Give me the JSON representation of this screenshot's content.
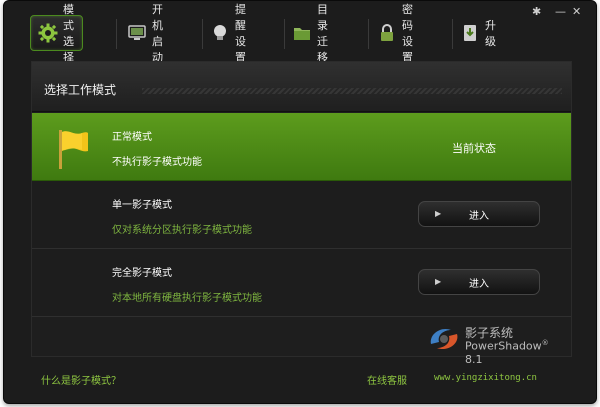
{
  "window": {
    "controls": {
      "settings": "✱",
      "minimize": "—",
      "close": "✕"
    }
  },
  "tabs": [
    {
      "label": "模式选择",
      "icon": "gear-icon",
      "active": true
    },
    {
      "label": "开机启动",
      "icon": "computer-icon",
      "active": false
    },
    {
      "label": "提醒设置",
      "icon": "lightbulb-icon",
      "active": false
    },
    {
      "label": "目录迁移",
      "icon": "folder-icon",
      "active": false
    },
    {
      "label": "密码设置",
      "icon": "lock-icon",
      "active": false
    },
    {
      "label": "升级",
      "icon": "download-icon",
      "active": false
    }
  ],
  "panel": {
    "title": "选择工作模式",
    "modes": [
      {
        "title": "正常模式",
        "desc": "不执行影子模式功能",
        "status": "当前状态",
        "icon": "flag-icon"
      },
      {
        "title": "单一影子模式",
        "desc": "仅对系统分区执行影子模式功能",
        "button": "进入"
      },
      {
        "title": "完全影子模式",
        "desc": "对本地所有硬盘执行影子模式功能",
        "button": "进入"
      }
    ]
  },
  "logo": {
    "name": "影子系统",
    "version_text": "PowerShadow",
    "version_mark": "®",
    "version_num": "8.1"
  },
  "footer": {
    "what_link": "什么是影子模式？",
    "service_link": "在线客服",
    "site_link": "www.yingzixitong.cn"
  },
  "colors": {
    "accent": "#5d9c1d",
    "link": "#8ec641",
    "background": "#1c1c1c"
  }
}
